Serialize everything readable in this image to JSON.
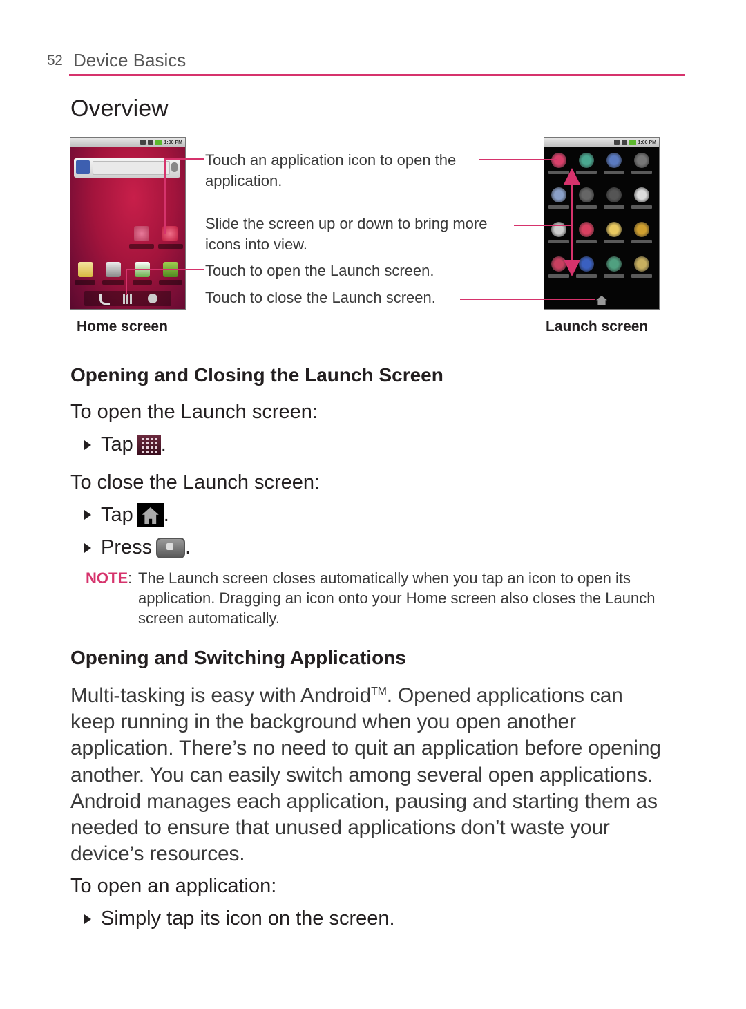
{
  "header": {
    "page_number": "52",
    "section": "Device Basics",
    "accent_color": "#d6336c"
  },
  "overview": {
    "title": "Overview",
    "callouts": [
      {
        "line1": "Touch an application icon to open the",
        "line2": "application."
      },
      {
        "line1": "Slide the screen up or down to bring more",
        "line2": "icons into view."
      },
      {
        "line1": "Touch to open the Launch screen."
      },
      {
        "line1": "Touch to close the Launch screen."
      }
    ],
    "home_caption": "Home screen",
    "launch_caption": "Launch screen"
  },
  "launch_section": {
    "heading": "Opening and Closing the Launch Screen",
    "open_heading": "To open the Launch screen:",
    "open_steps": [
      {
        "verb": "Tap",
        "icon": "launcher-grid-icon",
        "suffix": "."
      }
    ],
    "close_heading": "To close the Launch screen:",
    "close_steps": [
      {
        "verb": "Tap",
        "icon": "home-icon",
        "suffix": "."
      },
      {
        "verb": "Press",
        "icon": "home-key-icon",
        "suffix": "."
      }
    ],
    "note_label": "NOTE",
    "note_text": "The Launch screen closes automatically when you tap an icon to open its application. Dragging an icon onto your Home screen also closes the Launch screen automatically."
  },
  "switching_section": {
    "heading": "Opening and Switching Applications",
    "para_prefix": "Multi-tasking is easy with Android",
    "trademark": "TM",
    "para_rest": ". Opened applications can keep running in the background when you open another application. There’s no need to quit an application before opening another. You can easily switch among several open applications. Android manages each application, pausing and starting them as needed to ensure that unused applications don’t waste your device’s resources.",
    "open_app_heading": "To open an application:",
    "open_app_steps": [
      "Simply tap its icon on the screen."
    ]
  }
}
